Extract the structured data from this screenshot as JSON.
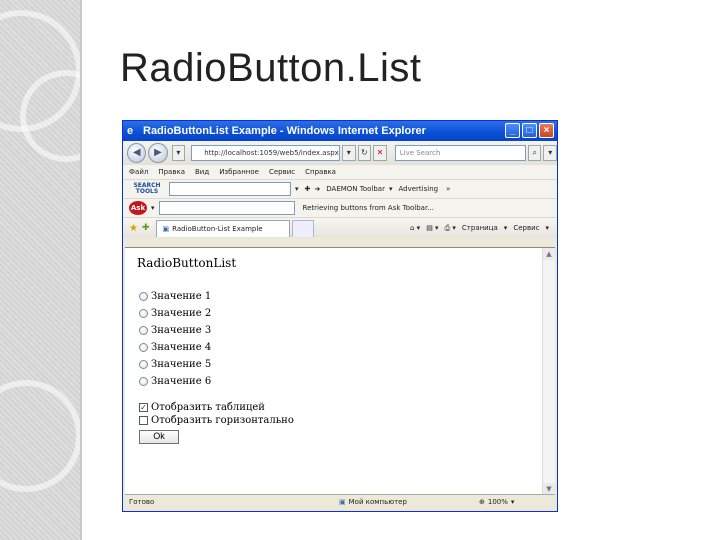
{
  "slide": {
    "title": "RadioButton.List"
  },
  "window": {
    "title": "RadioButtonList Example - Windows Internet Explorer",
    "buttons": {
      "minimize": "_",
      "maximize": "□",
      "close": "×"
    }
  },
  "address_bar": {
    "url": "http://localhost:1059/web5/index.aspx",
    "search_placeholder": "Live Search"
  },
  "menu": [
    "Файл",
    "Правка",
    "Вид",
    "Избранное",
    "Сервис",
    "Справка"
  ],
  "toolbar": {
    "badge": "SEARCH TOOLS",
    "links": [
      "DAEMON Toolbar",
      "Advertising"
    ],
    "ask_logo": "Ask",
    "ask_text": "Retrieving buttons from Ask Toolbar..."
  },
  "tab": {
    "label": "RadioButton-List Example"
  },
  "commands": [
    "Страница",
    "Сервис"
  ],
  "page": {
    "heading": "RadioButtonList",
    "radio_items": [
      "Значение 1",
      "Значение 2",
      "Значение 3",
      "Значение 4",
      "Значение 5",
      "Значение 6"
    ],
    "checkboxes": [
      {
        "label": "Отобразить таблицей",
        "checked": true
      },
      {
        "label": "Отобразить горизонтально",
        "checked": false
      }
    ],
    "ok_label": "Ok"
  },
  "status": {
    "left": "Готово",
    "zone": "Мой компьютер",
    "zoom": "100%"
  }
}
